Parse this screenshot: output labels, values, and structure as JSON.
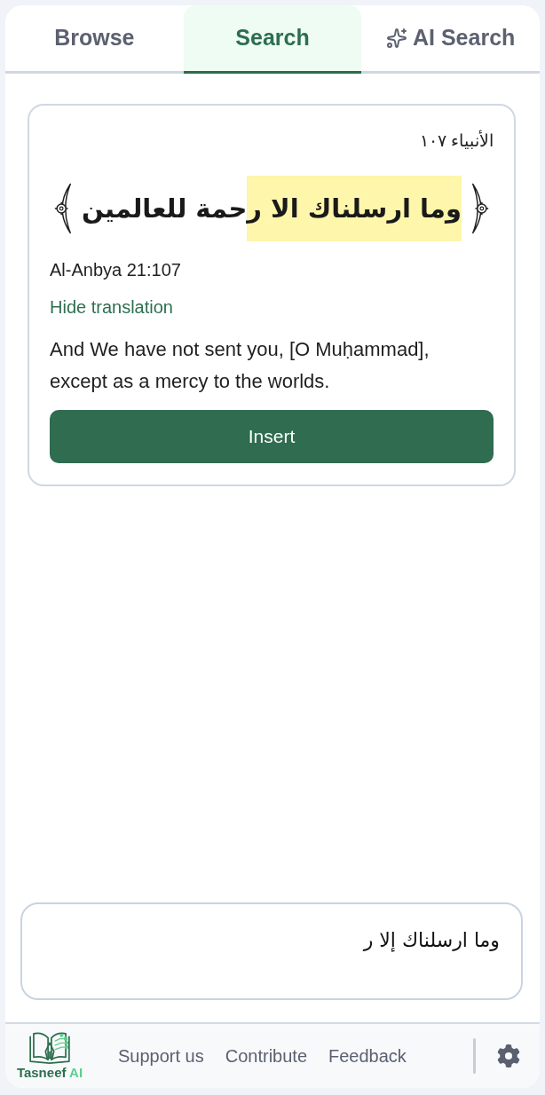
{
  "tabs": [
    {
      "label": "Browse",
      "selected": false,
      "kind": "plain"
    },
    {
      "label": "Search",
      "selected": true,
      "kind": "plain"
    },
    {
      "label": "AI Search",
      "selected": false,
      "kind": "ai"
    }
  ],
  "result": {
    "reference": "الأنبياء ١٠٧",
    "verse": {
      "segments": [
        {
          "text": "وما ارسلناك الا ر",
          "highlighted": true
        },
        {
          "text": "حمة للعالمين",
          "highlighted": false
        }
      ]
    },
    "citation": "Al-Anbya 21:107",
    "toggle": "Hide translation",
    "translation": "And We have not sent you, [O Muḥammad], except as a mercy to the worlds.",
    "button": "Insert"
  },
  "search": {
    "value": "وما ارسلناك إلا ر"
  },
  "footer": {
    "brand": {
      "name": "Tasneef",
      "suffix": "AI"
    },
    "links": [
      "Support us",
      "Contribute",
      "Feedback"
    ]
  }
}
